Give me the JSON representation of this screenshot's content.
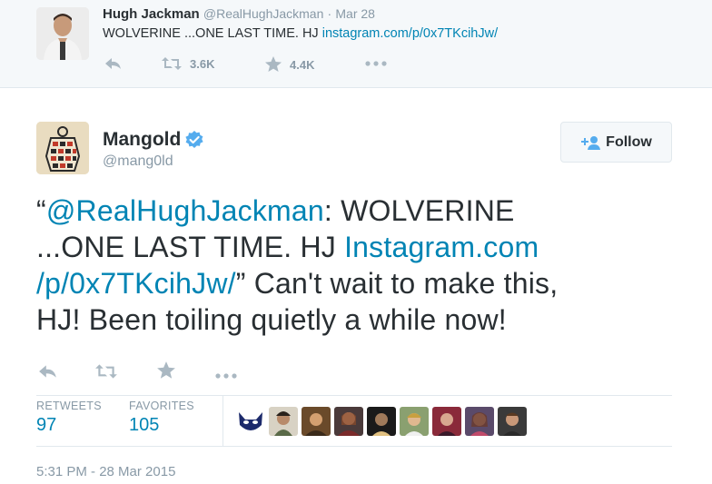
{
  "parent_tweet": {
    "name": "Hugh Jackman",
    "handle": "@RealHughJackman",
    "separator": "·",
    "date": "Mar 28",
    "text_plain": "WOLVERINE ...ONE LAST TIME. HJ ",
    "text_link": "instagram.com/p/0x7TKcihJw/",
    "retweet_count": "3.6K",
    "favorite_count": "4.4K"
  },
  "main_tweet": {
    "name": "Mangold",
    "handle": "@mang0ld",
    "follow_label": "Follow",
    "text": {
      "l1_open_quote": "“",
      "l1_mention": "@RealHughJackman",
      "l1_rest": ": WOLVERINE",
      "l2_rest": "...ONE LAST TIME. HJ ",
      "l2_link": "Instagram.com",
      "l3_link": "/p/0x7TKcihJw/",
      "l3_rest": "” Can't wait to make this,",
      "l4": "HJ! Been toiling quietly a while now!"
    },
    "stats": {
      "retweets_label": "RETWEETS",
      "retweets_value": "97",
      "favorites_label": "FAVORITES",
      "favorites_value": "105"
    },
    "timestamp": "5:31 PM - 28 Mar 2015"
  },
  "colors": {
    "link": "#0084b4",
    "muted": "#8899a6",
    "verified": "#55acee",
    "text": "#292f33"
  },
  "icons": {
    "reply": "reply-icon",
    "retweet": "retweet-icon",
    "favorite": "star-icon",
    "more": "more-icon",
    "verified": "verified-badge-icon",
    "follow": "follow-person-plus-icon"
  },
  "favoriter_avatar_count": 9
}
